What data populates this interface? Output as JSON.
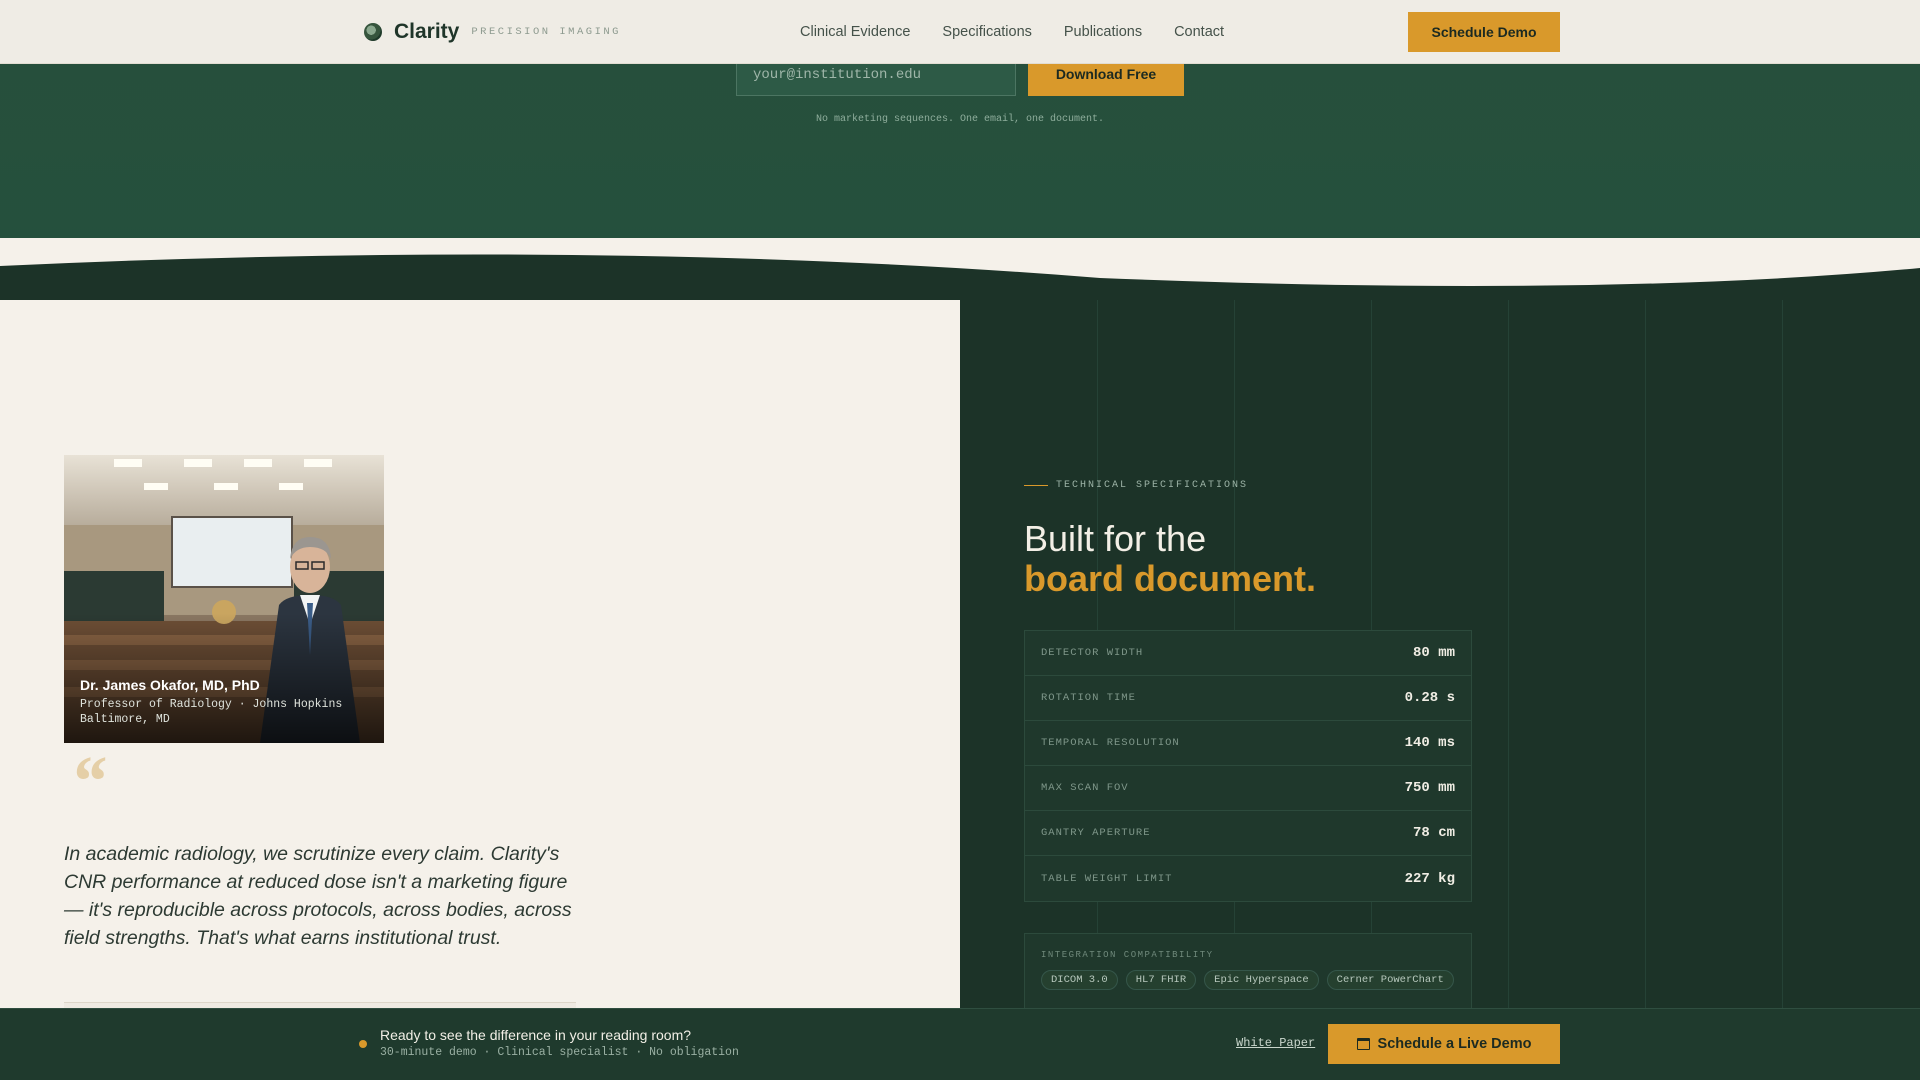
{
  "nav": {
    "brand_name": "Clarity",
    "brand_tag": "PRECISION IMAGING",
    "links": [
      "Clinical Evidence",
      "Specifications",
      "Publications",
      "Contact"
    ],
    "cta": "Schedule Demo"
  },
  "hero": {
    "email_placeholder": "your@institution.edu",
    "download_label": "Download Free",
    "note": "No marketing sequences. One email, one document."
  },
  "testimonial": {
    "name": "Dr. James Okafor, MD, PhD",
    "role": "Professor of Radiology · Johns Hopkins",
    "location": "Baltimore, MD",
    "quote_mark": "“",
    "quote": "In academic radiology, we scrutinize every claim. Clarity's CNR performance at reduced dose isn't a marketing figure — it's reproducible across protocols, across bodies, across field strengths. That's what earns institutional trust."
  },
  "specs": {
    "eyebrow": "TECHNICAL SPECIFICATIONS",
    "heading_line1": "Built for the",
    "heading_line2": "board document.",
    "rows": [
      {
        "label": "DETECTOR WIDTH",
        "value": "80 mm"
      },
      {
        "label": "ROTATION TIME",
        "value": "0.28 s"
      },
      {
        "label": "TEMPORAL RESOLUTION",
        "value": "140 ms"
      },
      {
        "label": "MAX SCAN FOV",
        "value": "750 mm"
      },
      {
        "label": "GANTRY APERTURE",
        "value": "78 cm"
      },
      {
        "label": "TABLE WEIGHT LIMIT",
        "value": "227 kg"
      }
    ],
    "integration_title": "INTEGRATION COMPATIBILITY",
    "chips": [
      "DICOM 3.0",
      "HL7 FHIR",
      "Epic Hyperspace",
      "Cerner PowerChart"
    ]
  },
  "cta_bar": {
    "title": "Ready to see the difference in your reading room?",
    "subtitle": "30-minute demo · Clinical specialist · No obligation",
    "link": "White Paper",
    "button": "Schedule a Live Demo"
  },
  "colors": {
    "accent": "#d9992b",
    "forest": "#1c3328",
    "cream": "#f5f1ea"
  }
}
